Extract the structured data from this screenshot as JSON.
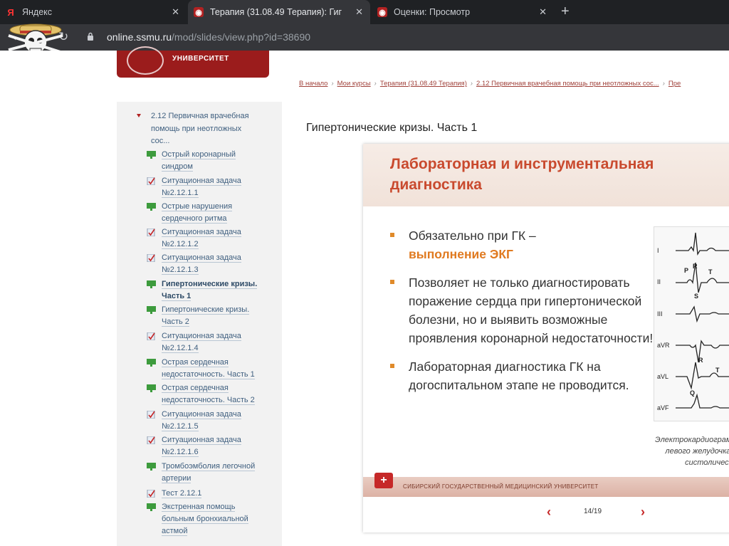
{
  "browser": {
    "tabs": [
      {
        "title": "Яндекс",
        "favicon": "yandex-icon",
        "active": false
      },
      {
        "title": "Терапия (31.08.49 Терапия): Гиг",
        "favicon": "university-seal-icon",
        "active": true
      },
      {
        "title": "Оценки: Просмотр",
        "favicon": "university-seal-icon",
        "active": false
      }
    ],
    "new_tab_label": "+",
    "url_host": "online.ssmu.ru",
    "url_path": "/mod/slides/view.php?id=38690"
  },
  "header": {
    "university_label": "УНИВЕРСИТЕТ"
  },
  "breadcrumbs": [
    "В начало",
    "Мои курсы",
    "Терапия (31.08.49 Терапия)",
    "2.12 Первичная врачебная помощь при неотложных сос...",
    "Пре"
  ],
  "sidebar": {
    "section_title": "2.12 Первичная врачебная помощь при неотложных сос...",
    "items": [
      {
        "label": "Острый коронарный синдром",
        "icon": "slides-icon"
      },
      {
        "label": "Ситуационная задача №2.12.1.1",
        "icon": "assignment-icon"
      },
      {
        "label": "Острые нарушения сердечного ритма",
        "icon": "slides-icon"
      },
      {
        "label": "Ситуационная задача №2.12.1.2",
        "icon": "assignment-icon"
      },
      {
        "label": "Ситуационная задача №2.12.1.3",
        "icon": "assignment-icon"
      },
      {
        "label": "Гипертонические кризы. Часть 1",
        "icon": "slides-icon",
        "current": true
      },
      {
        "label": "Гипертонические кризы. Часть 2",
        "icon": "slides-icon"
      },
      {
        "label": "Ситуационная задача №2.12.1.4",
        "icon": "assignment-icon"
      },
      {
        "label": "Острая сердечная недостаточность. Часть 1",
        "icon": "slides-icon"
      },
      {
        "label": "Острая сердечная недостаточность. Часть 2",
        "icon": "slides-icon"
      },
      {
        "label": "Ситуационная задача №2.12.1.5",
        "icon": "assignment-icon"
      },
      {
        "label": "Ситуационная задача №2.12.1.6",
        "icon": "assignment-icon"
      },
      {
        "label": "Тромбоэмболия легочной артерии",
        "icon": "slides-icon"
      },
      {
        "label": "Тест 2.12.1",
        "icon": "assignment-icon"
      },
      {
        "label": "Экстренная помощь больным бронхиальной астмой",
        "icon": "slides-icon"
      }
    ]
  },
  "main": {
    "title": "Гипертонические кризы. Часть 1"
  },
  "slide": {
    "title": "Лабораторная и инструментальная диагностика",
    "bullet1_text": "Обязательно при ГК –",
    "bullet1_highlight": "выполнение ЭКГ",
    "bullet2": "Позволяет не только диагностировать поражение сердца при гипертонической болезни, но и выявить возможные проявления коронарной недостаточности!",
    "bullet3": "Лабораторная диагностика ГК на догоспитальном этапе не проводится.",
    "ecg_leads": [
      "I",
      "II",
      "III",
      "aVR",
      "aVL",
      "aVF"
    ],
    "ecg_wave_labels": [
      "P",
      "R",
      "T",
      "S",
      "R",
      "T",
      "Q"
    ],
    "ecg_caption_lines": [
      "Электрокардиограмм",
      "левого желудочка с",
      "систолическо"
    ],
    "footer_text": "СИБИРСКИЙ ГОСУДАРСТВЕННЫЙ МЕДИЦИНСКИЙ УНИВЕРСИТЕТ",
    "accent_color": "#c94a2e"
  },
  "pager": {
    "prev": "‹",
    "next": "›",
    "count": "14/19"
  }
}
